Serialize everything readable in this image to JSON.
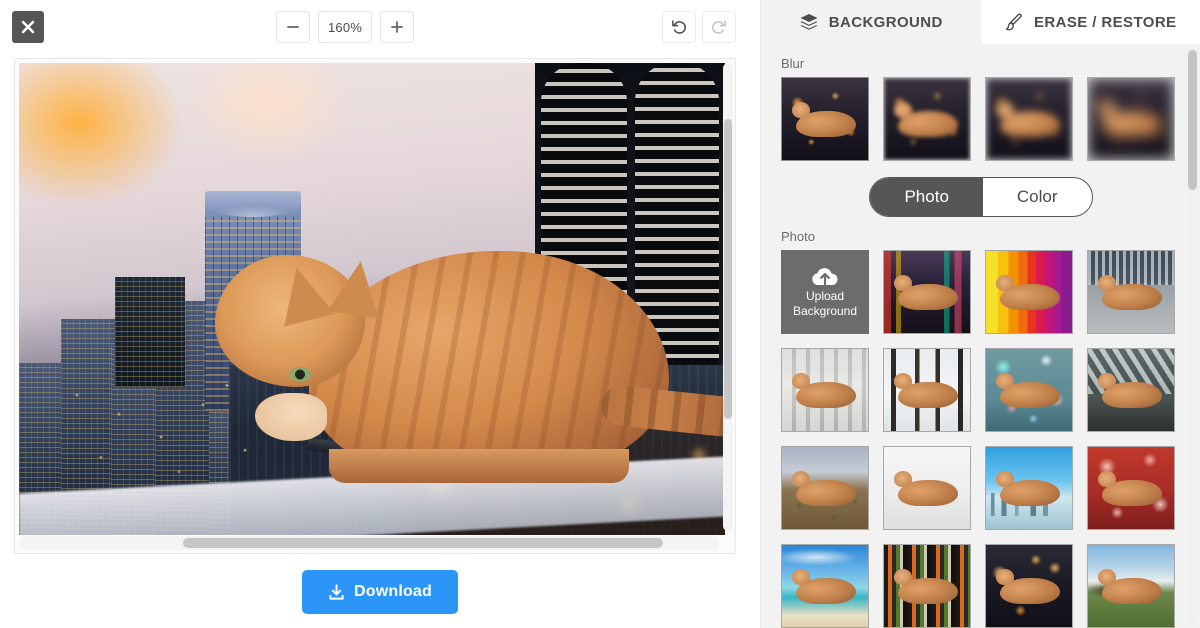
{
  "editor": {
    "close_label": "×",
    "close_icon": "close-icon",
    "zoom": {
      "minus_label": "−",
      "value": "160%",
      "plus_label": "+"
    },
    "history": {
      "undo_icon": "undo-icon",
      "redo_icon": "redo-icon"
    },
    "canvas": {
      "subject": "orange tabby cat",
      "background_scene": "city skyline at dusk with river and bridges"
    },
    "download_label": "Download",
    "download_icon": "download-icon",
    "download_color": "#2b96f7"
  },
  "panel": {
    "tabs": [
      {
        "label": "BACKGROUND",
        "icon": "layers-icon",
        "active": false
      },
      {
        "label": "ERASE / RESTORE",
        "icon": "brush-icon",
        "active": true
      }
    ],
    "blur": {
      "label": "Blur",
      "options": [
        {
          "name": "blur-none",
          "scene": "city-night",
          "selected": true
        },
        {
          "name": "blur-low",
          "scene": "city-night-blur-1",
          "selected": false
        },
        {
          "name": "blur-medium",
          "scene": "city-night-blur-2",
          "selected": false
        },
        {
          "name": "blur-high",
          "scene": "city-night-blur-3",
          "selected": false
        }
      ]
    },
    "source_toggle": {
      "photo_label": "Photo",
      "color_label": "Color",
      "selected": "Photo"
    },
    "photo": {
      "label": "Photo",
      "upload": {
        "line1": "Upload",
        "line2": "Background",
        "icon": "cloud-upload-icon"
      },
      "thumbnails": [
        {
          "name": "bg-tokyo-street",
          "css": "bg-tokyo"
        },
        {
          "name": "bg-rainbow-stripes",
          "css": "bg-rainbow"
        },
        {
          "name": "bg-concrete-plaza",
          "css": "bg-plaza"
        },
        {
          "name": "bg-parking-garage",
          "css": "bg-garage"
        },
        {
          "name": "bg-snowy-path",
          "css": "bg-snow"
        },
        {
          "name": "bg-teal-bokeh",
          "css": "bg-bokeh-teal"
        },
        {
          "name": "bg-architecture-interior",
          "css": "bg-arch"
        },
        {
          "name": "bg-desert-landscape",
          "css": "bg-desert"
        },
        {
          "name": "bg-plain-white",
          "css": "bg-white"
        },
        {
          "name": "bg-toronto-skyline",
          "css": "bg-toronto"
        },
        {
          "name": "bg-red-bokeh",
          "css": "bg-bokeh-red"
        },
        {
          "name": "bg-tropical-beach",
          "css": "bg-beach"
        },
        {
          "name": "bg-color-stripes",
          "css": "bg-stripes"
        },
        {
          "name": "bg-city-lights",
          "css": "bg-citylight"
        },
        {
          "name": "bg-countryside-cabin",
          "css": "bg-country"
        }
      ]
    }
  }
}
